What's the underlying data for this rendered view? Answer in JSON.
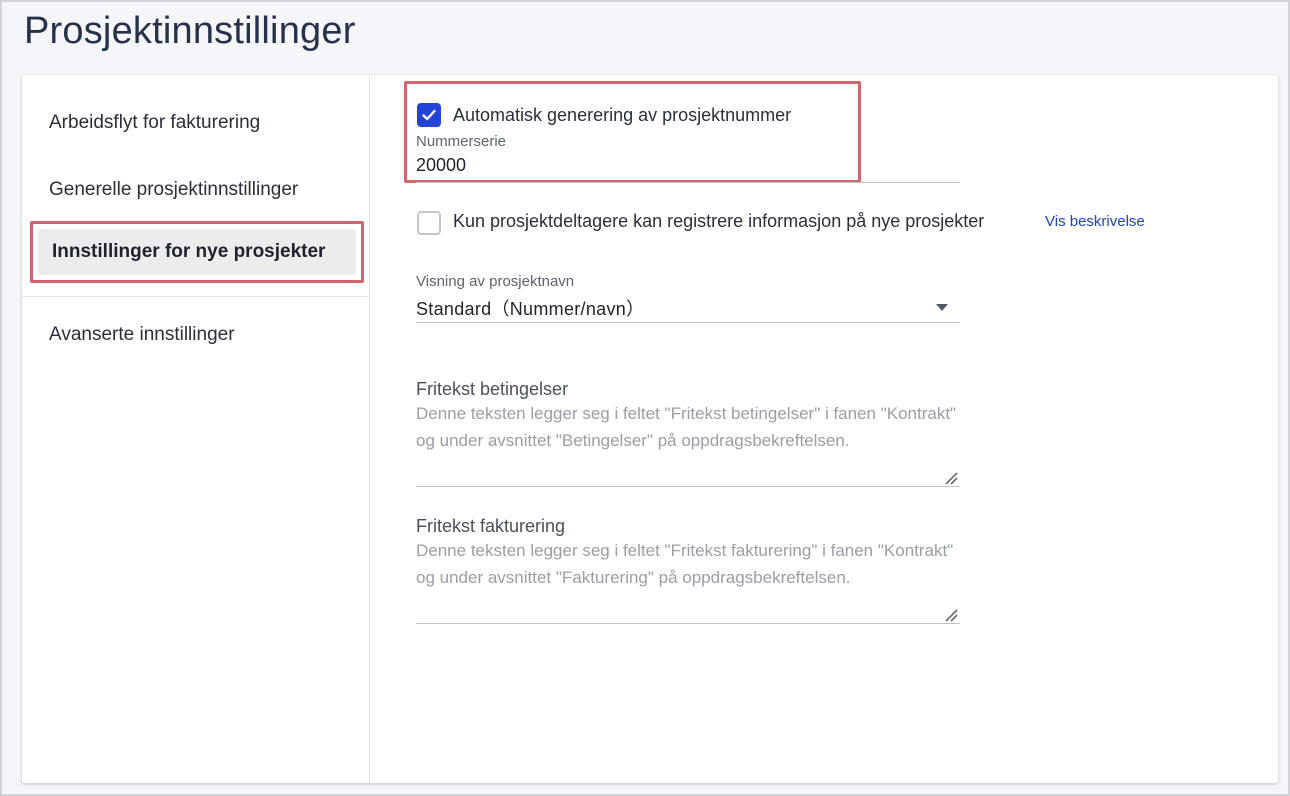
{
  "page": {
    "title": "Prosjektinnstillinger"
  },
  "sidebar": {
    "items": [
      {
        "label": "Arbeidsflyt for fakturering"
      },
      {
        "label": "Generelle prosjektinnstillinger"
      },
      {
        "label": "Innstillinger for nye prosjekter",
        "active": true
      },
      {
        "label": "Avanserte innstillinger"
      }
    ]
  },
  "settings": {
    "auto_number": {
      "label": "Automatisk generering av prosjektnummer",
      "checked": true,
      "series_label": "Nummerserie",
      "series_value": "20000"
    },
    "participants_only": {
      "label": "Kun prosjektdeltagere kan registrere informasjon på nye prosjekter",
      "checked": false,
      "link": "Vis beskrivelse"
    },
    "name_display": {
      "label": "Visning av prosjektnavn",
      "value": "Standard（Nummer/navn）"
    },
    "terms_text": {
      "label": "Fritekst betingelser",
      "placeholder": "Denne teksten legger seg i feltet \"Fritekst betingelser\" i fanen \"Kontrakt\" og under avsnittet \"Betingelser\" på oppdragsbekreftelsen."
    },
    "invoice_text": {
      "label": "Fritekst fakturering",
      "placeholder": "Denne teksten legger seg i feltet \"Fritekst fakturering\" i fanen \"Kontrakt\" og under avsnittet \"Fakturering\" på oppdragsbekreftelsen."
    }
  },
  "colors": {
    "accent": "#2444d6",
    "highlight": "#d0646f",
    "link": "#1f44c9"
  }
}
